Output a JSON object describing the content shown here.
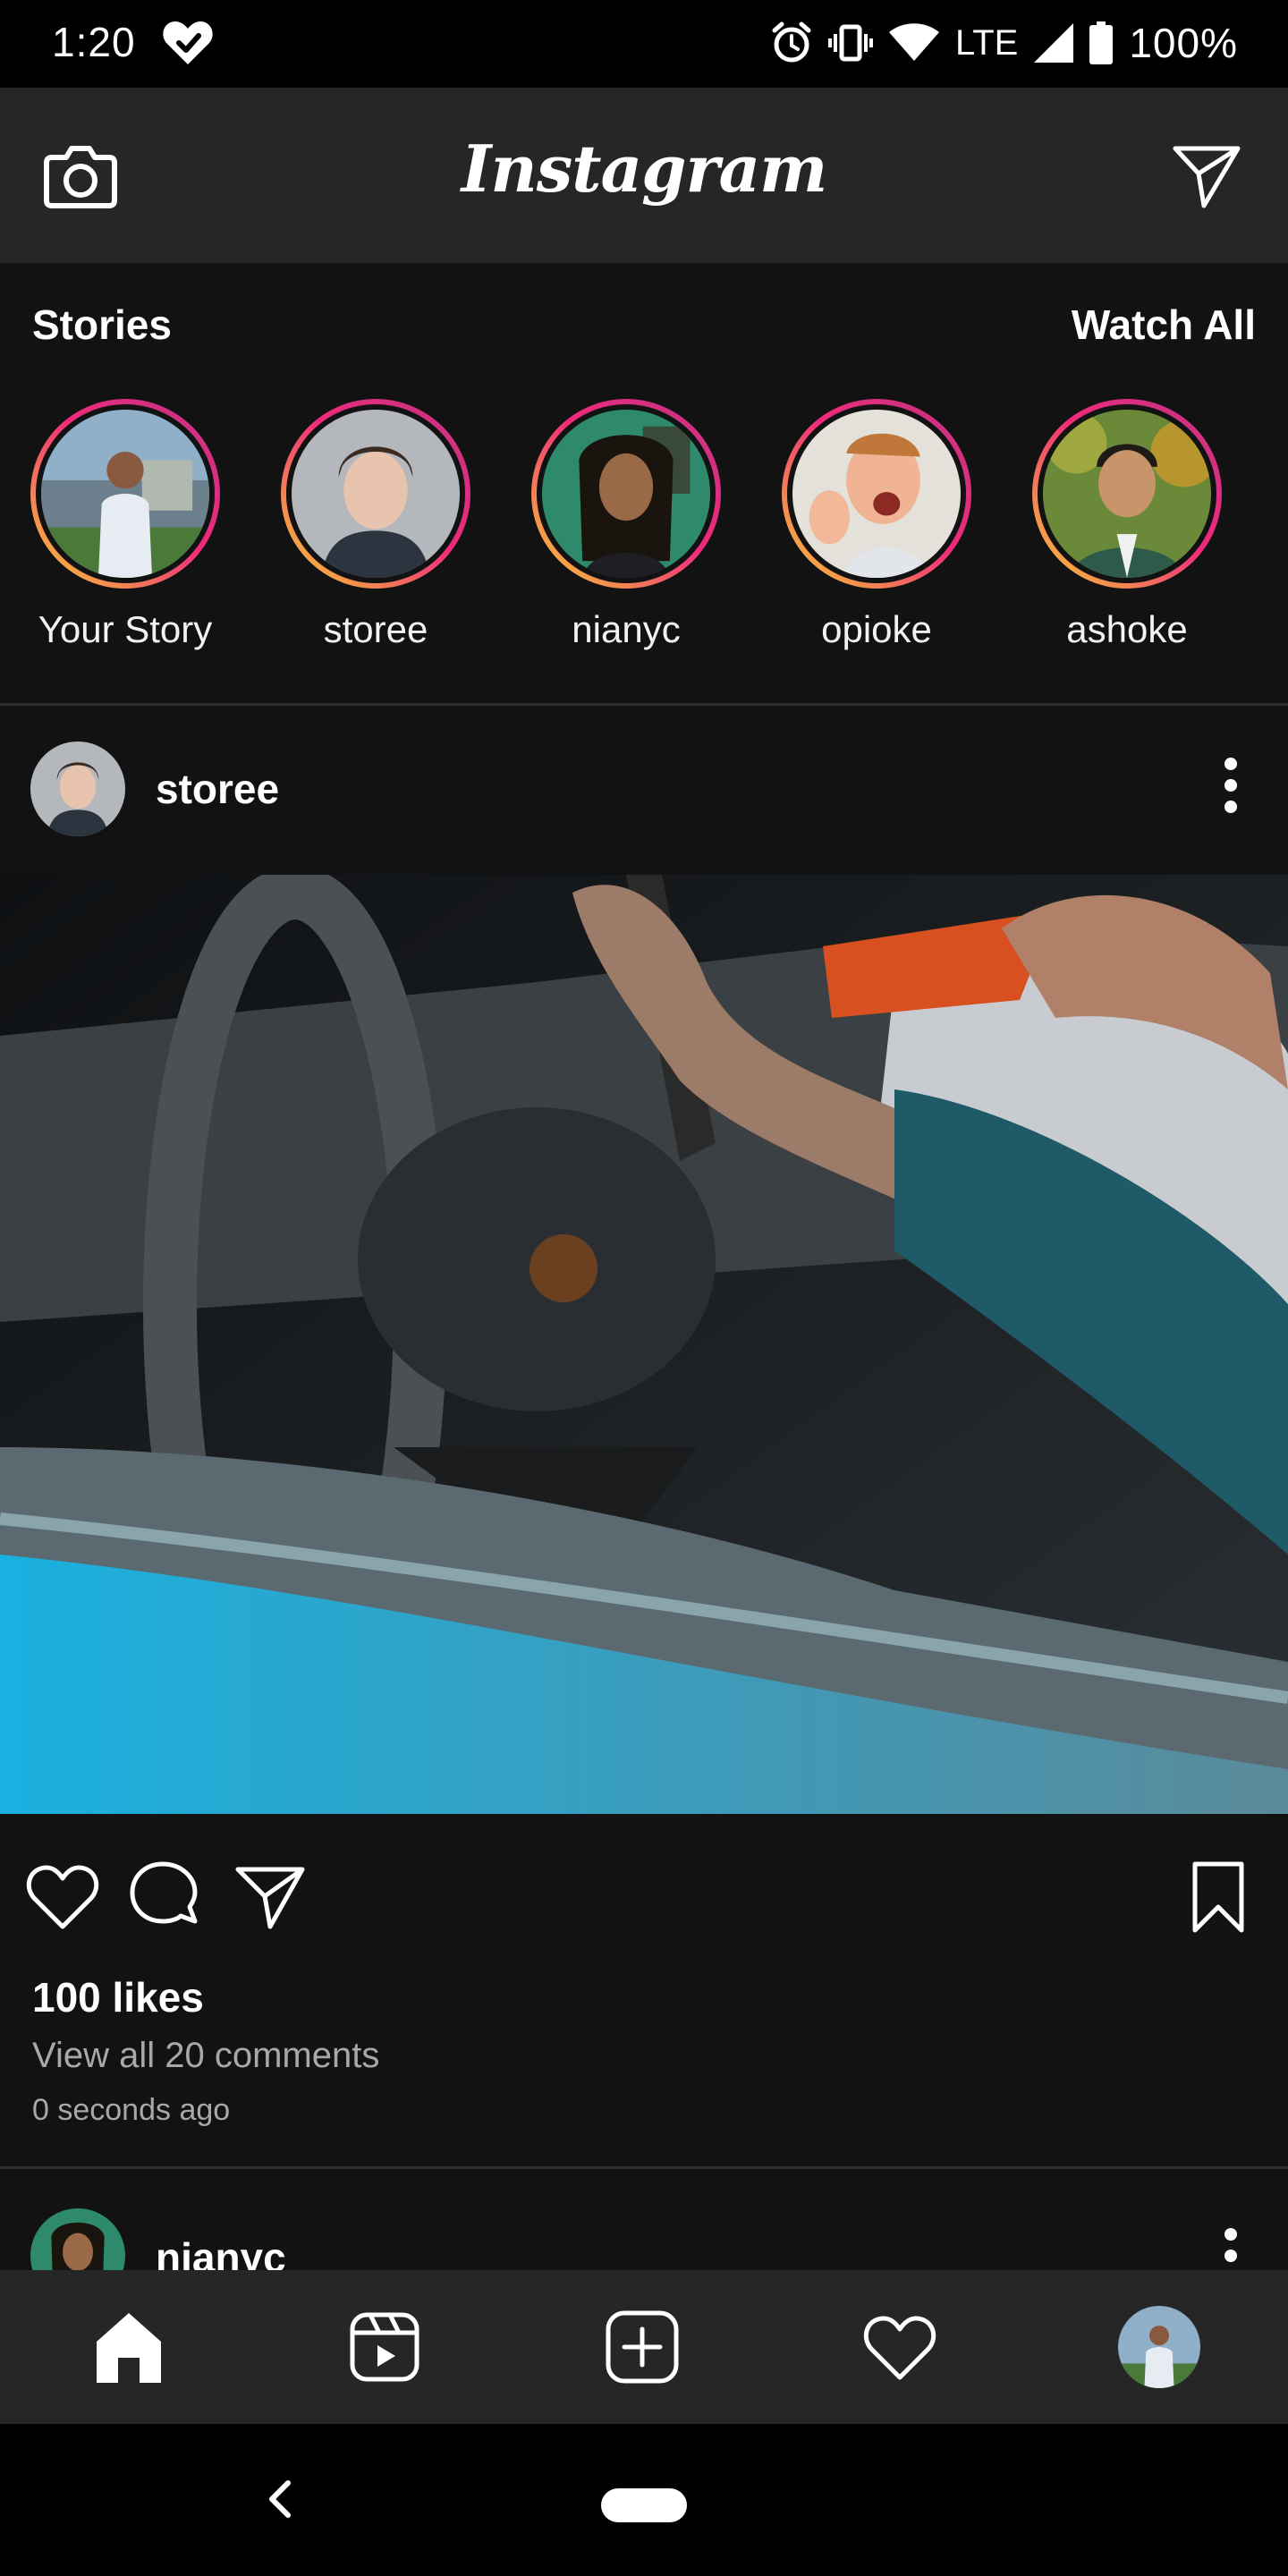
{
  "status_bar": {
    "time": "1:20",
    "network": "LTE",
    "battery": "100%",
    "icons": [
      "heart-check-icon",
      "alarm-icon",
      "vibrate-icon",
      "wifi-icon",
      "signal-icon",
      "battery-icon"
    ]
  },
  "top_bar": {
    "logo": "Instagram",
    "camera_icon": "camera-icon",
    "dm_icon": "send-icon"
  },
  "stories": {
    "title": "Stories",
    "watch_all": "Watch All",
    "items": [
      {
        "label": "Your Story"
      },
      {
        "label": "storee"
      },
      {
        "label": "nianyc"
      },
      {
        "label": "opioke"
      },
      {
        "label": "ashoke"
      }
    ]
  },
  "posts": [
    {
      "username": "storee",
      "likes": "100 likes",
      "view_comments": "View all 20 comments",
      "timestamp": "0 seconds ago"
    },
    {
      "username": "nianyc"
    }
  ],
  "bottom_nav": {
    "items": [
      "home-icon",
      "reels-icon",
      "new-post-icon",
      "activity-icon",
      "profile-avatar"
    ]
  },
  "colors": {
    "background": "#121212",
    "bar": "#262626",
    "story_ring_start": "#f9ce34",
    "story_ring_end": "#c13584",
    "secondary_text": "#a8a8a8"
  }
}
